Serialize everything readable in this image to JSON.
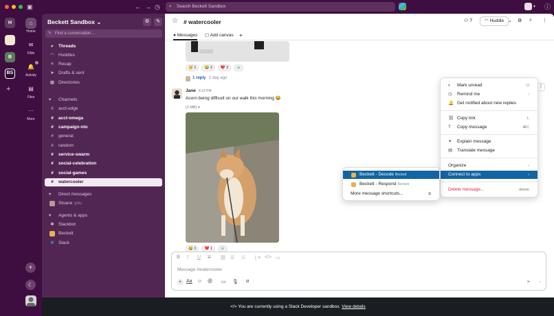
{
  "colors": {
    "aubergine": "#3f0e40",
    "sidebar": "#522653",
    "accent": "#1264a3",
    "danger": "#e01e5a"
  },
  "topbar": {
    "search_placeholder": "Search Beckett Sandbox"
  },
  "rail": {
    "workspaces": [
      "H",
      "",
      "B",
      "BS"
    ]
  },
  "nav": {
    "home": "Home",
    "dms": "DMs",
    "activity": "Activity",
    "activity_badge": "7",
    "files": "Files",
    "more": "More"
  },
  "sidebar": {
    "workspace_name": "Beckett Sandbox",
    "find_placeholder": "Find a conversation...",
    "top_items": [
      "Threads",
      "Huddles",
      "Recap",
      "Drafts & sent",
      "Directories"
    ],
    "channels_header": "Channels",
    "channels": [
      {
        "name": "acct-edge",
        "bold": false
      },
      {
        "name": "acct-omega",
        "bold": true
      },
      {
        "name": "campaign-nto",
        "bold": true
      },
      {
        "name": "general",
        "bold": false
      },
      {
        "name": "random",
        "bold": false
      },
      {
        "name": "service-swarm",
        "bold": true
      },
      {
        "name": "social-celebration",
        "bold": true
      },
      {
        "name": "social-games",
        "bold": true
      },
      {
        "name": "watercooler",
        "bold": true,
        "selected": true
      }
    ],
    "dm_header": "Direct messages",
    "dm_user": "Sloane",
    "dm_you": "you",
    "apps_header": "Agents & apps",
    "apps": [
      "Slackbot",
      "Beckett",
      "Slack"
    ]
  },
  "channel": {
    "name": "# watercooler",
    "member_count": "7",
    "huddle_label": "Huddle",
    "tabs": [
      "Messages",
      "Add canvas"
    ]
  },
  "messages": {
    "prev_reactions": [
      "🥳 1",
      "😂 2",
      "❤️ 2"
    ],
    "reply_link": "1 reply",
    "reply_time": "1 day ago",
    "author": "Jane",
    "time": "6:15 PM",
    "text": "Acorn being difficult on our walk this morning 😂",
    "file_size": "(2 MB) ▾",
    "reactions": [
      "😂 1",
      "❤️ 1"
    ]
  },
  "composer": {
    "placeholder": "Message #watercooler"
  },
  "context_menu": {
    "items": [
      {
        "label": "Mark unread",
        "shortcut": "U",
        "icon": "mark-unread-icon"
      },
      {
        "label": "Remind me",
        "shortcut": "›",
        "icon": "clock-icon"
      },
      {
        "label": "Get notified about new replies",
        "shortcut": "",
        "icon": "bell-icon"
      },
      {
        "label": "Copy link",
        "shortcut": "L",
        "icon": "link-icon"
      },
      {
        "label": "Copy message",
        "shortcut": "⌘C",
        "icon": "text-icon"
      },
      {
        "label": "Explain message",
        "shortcut": "",
        "icon": "sparkle-icon"
      },
      {
        "label": "Translate message",
        "shortcut": "",
        "icon": "translate-icon"
      },
      {
        "label": "Organize",
        "shortcut": "›",
        "icon": ""
      },
      {
        "label": "Connect to apps",
        "shortcut": "›",
        "icon": ""
      },
      {
        "label": "Delete message...",
        "shortcut": "delete",
        "icon": ""
      }
    ]
  },
  "apps_submenu": {
    "items": [
      {
        "label": "Beckett - Decode",
        "by": "Beckett"
      },
      {
        "label": "Beckett - Respond",
        "by": "Beckett"
      }
    ],
    "more": "More message shortcuts..."
  },
  "banner": {
    "text": "You are currently using a Slack Developer sandbox.",
    "link": "View details"
  }
}
